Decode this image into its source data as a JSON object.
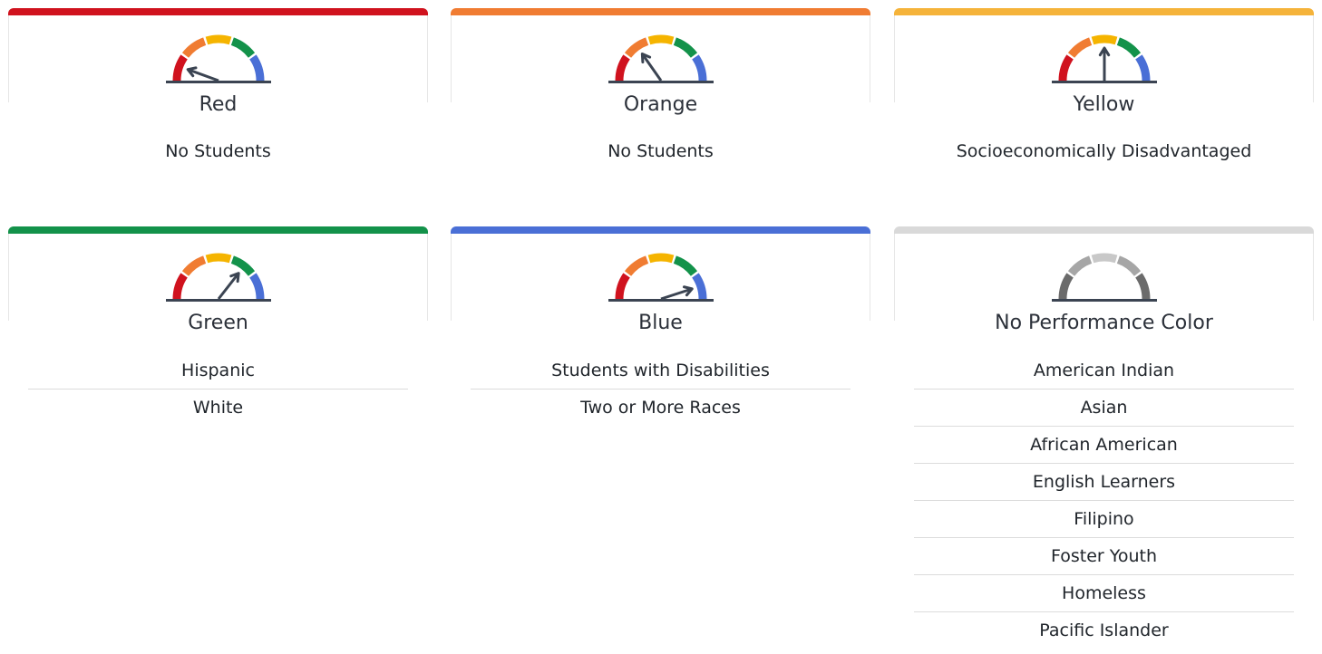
{
  "cards": [
    {
      "key": "red",
      "label": "Red",
      "color": "#d0121e",
      "groups": [
        "No Students"
      ],
      "needle_angle": 160
    },
    {
      "key": "orange",
      "label": "Orange",
      "color": "#f07c32",
      "groups": [
        "No Students"
      ],
      "needle_angle": 125
    },
    {
      "key": "yellow",
      "label": "Yellow",
      "color": "#f5b33a",
      "groups": [
        "Socioeconomically Disadvantaged"
      ],
      "needle_angle": 90
    },
    {
      "key": "green",
      "label": "Green",
      "color": "#13924a",
      "groups": [
        "Hispanic",
        "White"
      ],
      "needle_angle": 52
    },
    {
      "key": "blue",
      "label": "Blue",
      "color": "#4a6fd6",
      "groups": [
        "Students with Disabilities",
        "Two or More Races"
      ],
      "needle_angle": 18
    },
    {
      "key": "none",
      "label": "No Performance Color",
      "color": "#d9d9d9",
      "groups": [
        "American Indian",
        "Asian",
        "African American",
        "English Learners",
        "Filipino",
        "Foster Youth",
        "Homeless",
        "Pacific Islander"
      ],
      "needle_angle": null
    }
  ],
  "gauge_colors": {
    "red": "#d0121e",
    "orange": "#f07c32",
    "yellow": "#f5b400",
    "green": "#13924a",
    "blue": "#4a6fd6",
    "gray_dark": "#6b6b6b",
    "gray_mid": "#a6a6a6",
    "gray_light": "#c8c8c8",
    "needle": "#3b4452"
  }
}
